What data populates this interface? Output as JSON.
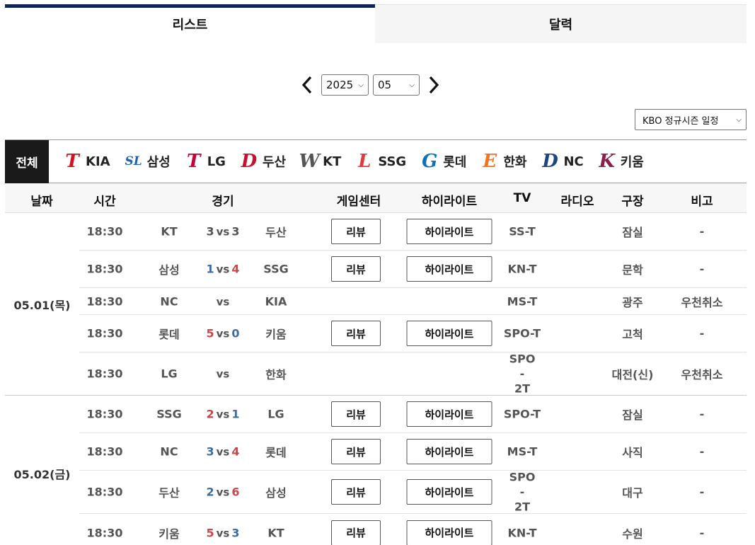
{
  "tabs": [
    {
      "label": "리스트",
      "active": true
    },
    {
      "label": "달력",
      "active": false
    }
  ],
  "month_nav": {
    "year": "2025",
    "month": "05"
  },
  "season_select": "KBO 정규시즌 일정",
  "teams": {
    "all": "전체",
    "items": [
      {
        "name": "KIA",
        "mark": "T",
        "color": "#d4121f"
      },
      {
        "name": "삼성",
        "mark": "SL",
        "color": "#1e64b4"
      },
      {
        "name": "LG",
        "mark": "T",
        "color": "#c30037"
      },
      {
        "name": "두산",
        "mark": "D",
        "color": "#c8102e"
      },
      {
        "name": "KT",
        "mark": "W",
        "color": "#555555"
      },
      {
        "name": "SSG",
        "mark": "L",
        "color": "#e03a3e"
      },
      {
        "name": "롯데",
        "mark": "G",
        "color": "#0a72b8"
      },
      {
        "name": "한화",
        "mark": "E",
        "color": "#f37321"
      },
      {
        "name": "NC",
        "mark": "D",
        "color": "#1d467f"
      },
      {
        "name": "키움",
        "mark": "K",
        "color": "#8b1e4b"
      }
    ]
  },
  "columns": [
    "날짜",
    "시간",
    "경기",
    "게임센터",
    "하이라이트",
    "TV",
    "라디오",
    "구장",
    "비고"
  ],
  "buttons": {
    "review": "리뷰",
    "highlight": "하이라이트"
  },
  "vs": "vs",
  "schedule": [
    {
      "date": "05.01(목)",
      "games": [
        {
          "time": "18:30",
          "away": "KT",
          "away_score": "3",
          "home_score": "3",
          "home": "두산",
          "result": "draw",
          "has_buttons": true,
          "tv": "SS-T",
          "radio": "",
          "stadium": "잠실",
          "note": "-"
        },
        {
          "time": "18:30",
          "away": "삼성",
          "away_score": "1",
          "home_score": "4",
          "home": "SSG",
          "result": "home",
          "has_buttons": true,
          "tv": "KN-T",
          "radio": "",
          "stadium": "문학",
          "note": "-"
        },
        {
          "time": "18:30",
          "away": "NC",
          "away_score": "",
          "home_score": "",
          "home": "KIA",
          "result": "none",
          "has_buttons": false,
          "tv": "MS-T",
          "radio": "",
          "stadium": "광주",
          "note": "우천취소"
        },
        {
          "time": "18:30",
          "away": "롯데",
          "away_score": "5",
          "home_score": "0",
          "home": "키움",
          "result": "away",
          "has_buttons": true,
          "tv": "SPO-T",
          "radio": "",
          "stadium": "고척",
          "note": "-"
        },
        {
          "time": "18:30",
          "away": "LG",
          "away_score": "",
          "home_score": "",
          "home": "한화",
          "result": "none",
          "has_buttons": false,
          "tv": "SPO-2T",
          "radio": "",
          "stadium": "대전(신)",
          "note": "우천취소"
        }
      ]
    },
    {
      "date": "05.02(금)",
      "games": [
        {
          "time": "18:30",
          "away": "SSG",
          "away_score": "2",
          "home_score": "1",
          "home": "LG",
          "result": "away",
          "has_buttons": true,
          "tv": "SPO-T",
          "radio": "",
          "stadium": "잠실",
          "note": "-"
        },
        {
          "time": "18:30",
          "away": "NC",
          "away_score": "3",
          "home_score": "4",
          "home": "롯데",
          "result": "home",
          "has_buttons": true,
          "tv": "MS-T",
          "radio": "",
          "stadium": "사직",
          "note": "-"
        },
        {
          "time": "18:30",
          "away": "두산",
          "away_score": "2",
          "home_score": "6",
          "home": "삼성",
          "result": "home",
          "has_buttons": true,
          "tv": "SPO-2T",
          "radio": "",
          "stadium": "대구",
          "note": "-"
        },
        {
          "time": "18:30",
          "away": "키움",
          "away_score": "5",
          "home_score": "3",
          "home": "KT",
          "result": "away",
          "has_buttons": true,
          "tv": "KN-T",
          "radio": "",
          "stadium": "수원",
          "note": "-"
        }
      ]
    }
  ]
}
